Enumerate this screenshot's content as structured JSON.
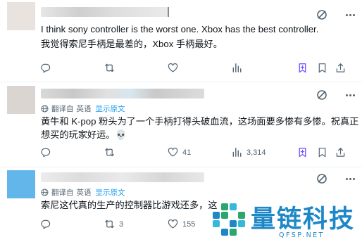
{
  "posts": [
    {
      "text": "I think sony controller is the worst one. Xbox has the best controller.",
      "text_translated": "我觉得索尼手柄是最差的，Xbox 手柄最好。",
      "actions": {
        "replies": "",
        "reposts": "",
        "likes": "",
        "views": ""
      }
    },
    {
      "translate": {
        "auto": "翻译自",
        "lang": "英语",
        "show": "显示原文"
      },
      "text_line1": "黄牛和 K-pop 粉头为了一个手柄打得头破血流，这场面要多惨有多惨。祝真正",
      "text_line2": "想买的玩家好运。💀",
      "actions": {
        "replies": "",
        "reposts": "",
        "likes": "41",
        "views": "3,314"
      }
    },
    {
      "translate": {
        "auto": "翻译自",
        "lang": "英语",
        "show": "显示原文"
      },
      "text": "索尼这代真的生产的控制器比游戏还多，这",
      "actions": {
        "replies": "",
        "reposts": "3",
        "likes": "155",
        "views": ""
      }
    }
  ],
  "watermark": {
    "title": "量链科技",
    "sub": "QFSP.NET"
  },
  "colors": {
    "accent": "#1d9bf0",
    "muted": "#536471",
    "watermark": "#1d87c7"
  }
}
